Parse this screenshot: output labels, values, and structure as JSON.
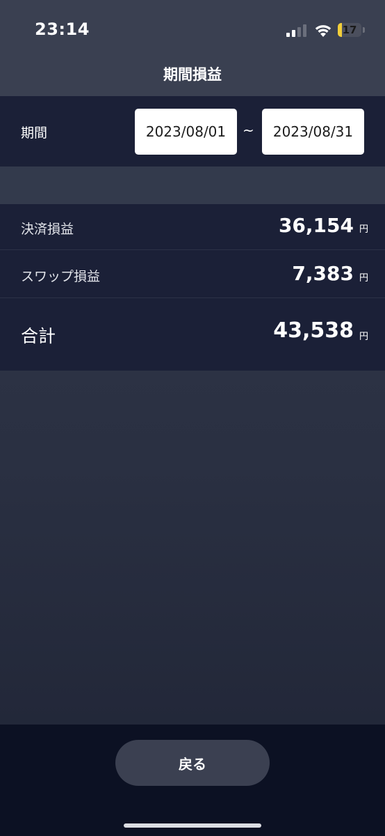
{
  "status_bar": {
    "time": "23:14",
    "battery_level": "17",
    "battery_fraction": 0.17,
    "battery_color": "#f2cf3a"
  },
  "nav": {
    "title": "期間損益"
  },
  "period": {
    "label": "期間",
    "start_date": "2023/08/01",
    "separator": "~",
    "end_date": "2023/08/31"
  },
  "results": {
    "settlement": {
      "label": "決済損益",
      "value": "36,154",
      "unit": "円"
    },
    "swap": {
      "label": "スワップ損益",
      "value": "7,383",
      "unit": "円"
    },
    "total": {
      "label": "合計",
      "value": "43,538",
      "unit": "円"
    }
  },
  "footer": {
    "back_label": "戻る"
  },
  "colors": {
    "panel_bg": "#1b2037",
    "header_bg": "#3a4051",
    "footer_bg": "#0c1123"
  },
  "icons": {
    "signal": "cellular-signal-icon",
    "wifi": "wifi-icon",
    "battery": "battery-icon"
  }
}
